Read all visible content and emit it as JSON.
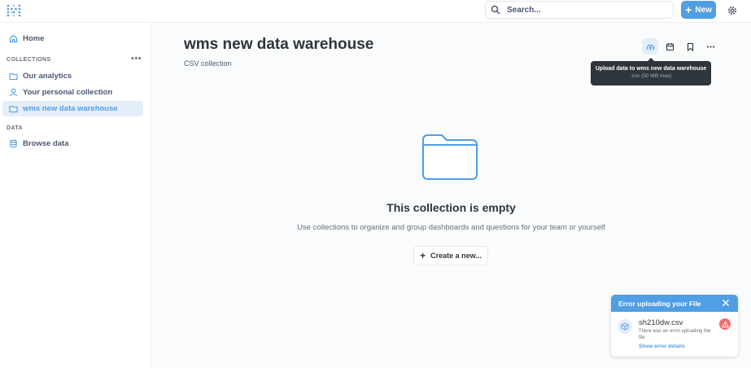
{
  "topbar": {
    "search_placeholder": "Search...",
    "new_label": "New"
  },
  "sidebar": {
    "home_label": "Home",
    "collections_label": "COLLECTIONS",
    "collections": [
      {
        "label": "Our analytics",
        "icon": "folder-icon"
      },
      {
        "label": "Your personal collection",
        "icon": "person-icon"
      },
      {
        "label": "wms new data warehouse",
        "icon": "folder-icon",
        "active": true
      }
    ],
    "data_label": "DATA",
    "browse_data_label": "Browse data"
  },
  "main": {
    "title": "wms new data warehouse",
    "subtitle": "CSV collection",
    "tooltip_title": "Upload data to wms new data warehouse",
    "tooltip_subtitle": ".csv (50 MB max)",
    "empty_title": "This collection is empty",
    "empty_description": "Use collections to organize and group dashboards and questions for your team or yourself",
    "create_label": "Create a new..."
  },
  "toast": {
    "title": "Error uploading your File",
    "file_name": "sh210dw.csv",
    "error_text": "There was an error uploading the file",
    "details_link": "Show error details"
  },
  "colors": {
    "brand": "#509ee3",
    "error": "#ed6e6e",
    "text_dark": "#2e353b"
  }
}
